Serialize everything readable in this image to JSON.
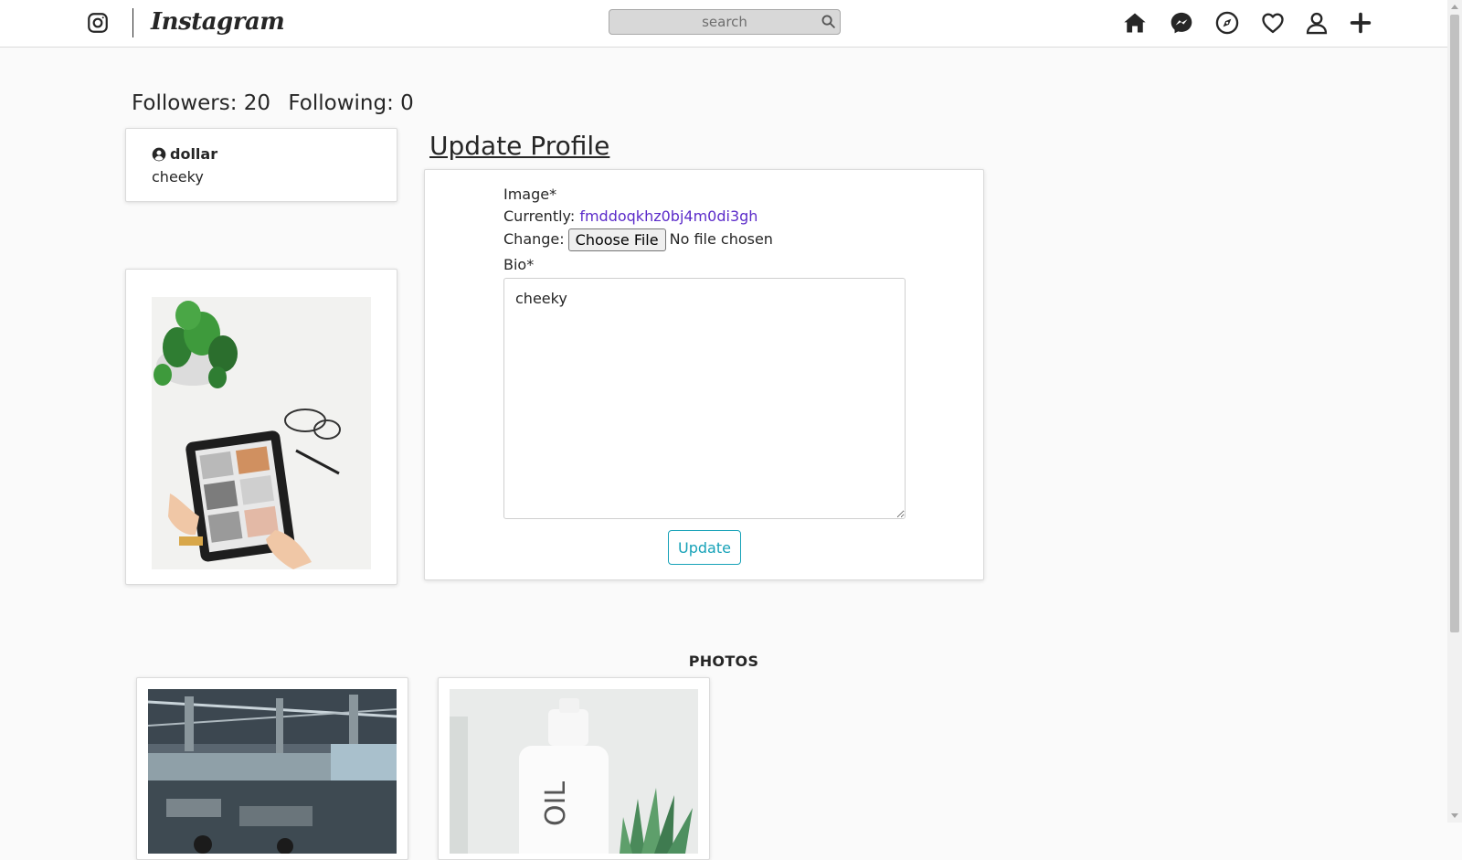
{
  "navbar": {
    "brand": "Instagram",
    "search_placeholder": "search",
    "icons": [
      "instagram-icon",
      "search-icon",
      "home-icon",
      "messenger-icon",
      "explore-icon",
      "heart-icon",
      "user-icon",
      "plus-icon"
    ]
  },
  "profile": {
    "followers_label": "Followers: 20",
    "following_label": "Following: 0",
    "username": "dollar",
    "bio": "cheeky"
  },
  "form": {
    "title": "Update Profile",
    "image_label": "Image*",
    "currently_label": "Currently:",
    "current_file": "fmddoqkhz0bj4m0di3gh",
    "change_label": "Change:",
    "choose_file_label": "Choose File",
    "no_file_text": "No file chosen",
    "bio_label": "Bio*",
    "bio_value": "cheeky",
    "submit_label": "Update"
  },
  "photos": {
    "heading": "PHOTOS"
  },
  "colors": {
    "accent": "#17a2b8",
    "link": "#5b2bc9",
    "border": "#dbdbdb",
    "background": "#fafafa"
  }
}
